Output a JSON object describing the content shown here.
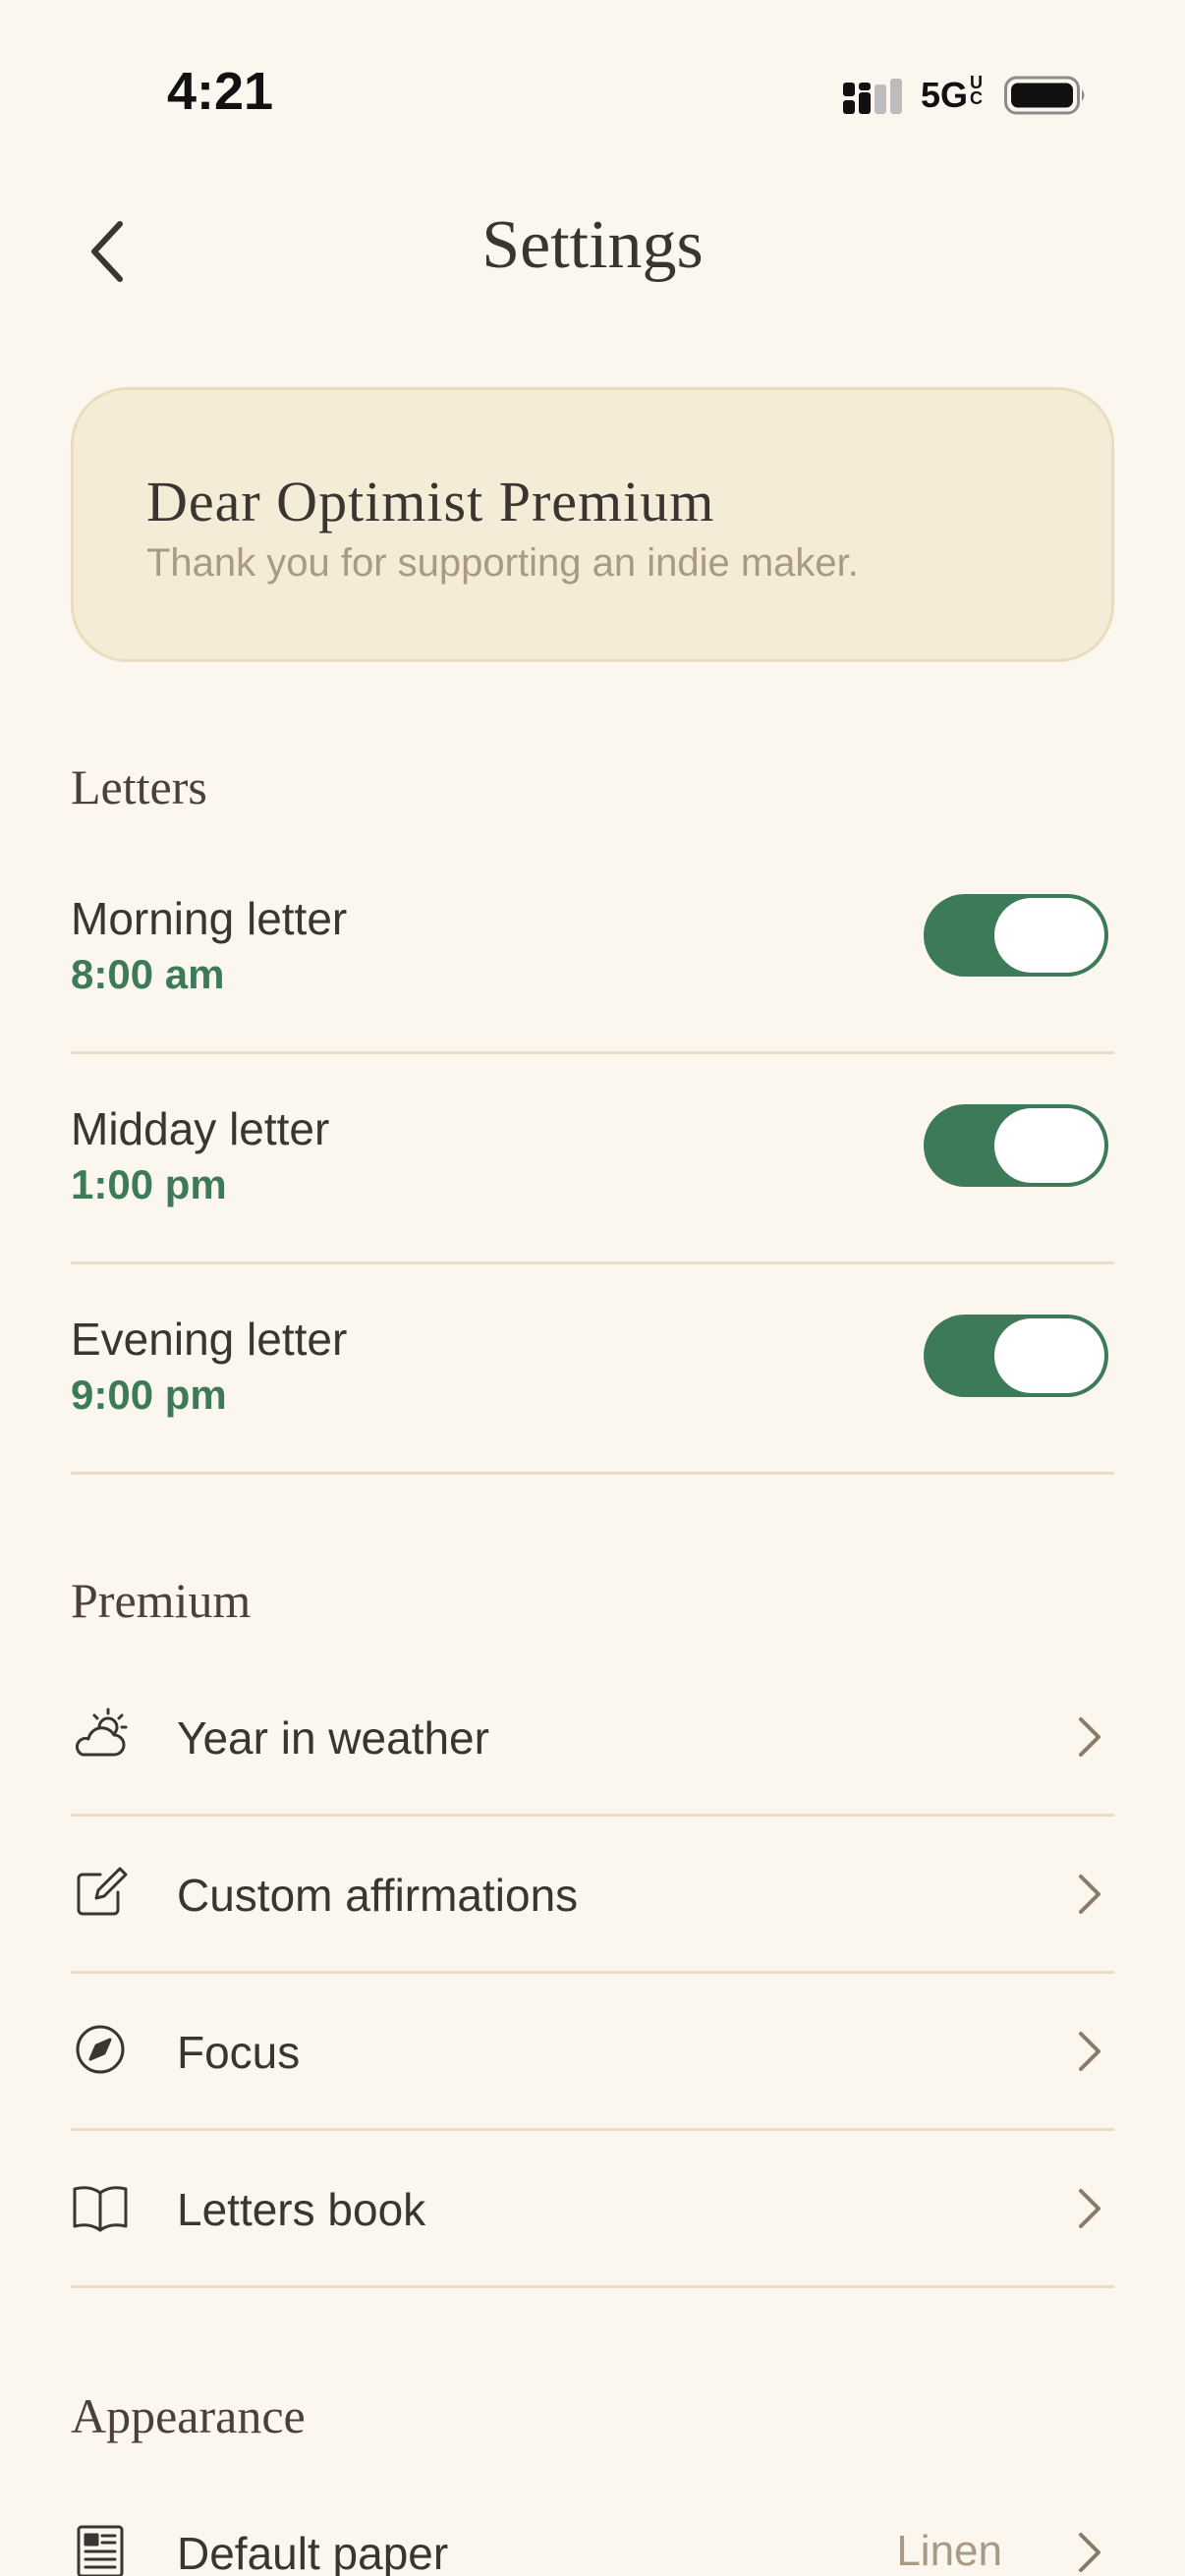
{
  "status_bar": {
    "time": "4:21",
    "network": "5G",
    "network_suffix": "UC"
  },
  "header": {
    "title": "Settings",
    "back_icon": "chevron-left-icon"
  },
  "premium_card": {
    "title": "Dear Optimist Premium",
    "subtitle": "Thank you for supporting an indie maker."
  },
  "letters": {
    "header": "Letters",
    "items": [
      {
        "label": "Morning letter",
        "time": "8:00 am",
        "enabled": true
      },
      {
        "label": "Midday letter",
        "time": "1:00 pm",
        "enabled": true
      },
      {
        "label": "Evening letter",
        "time": "9:00 pm",
        "enabled": true
      }
    ]
  },
  "premium": {
    "header": "Premium",
    "items": [
      {
        "label": "Year in weather",
        "icon": "cloud-sun-icon"
      },
      {
        "label": "Custom affirmations",
        "icon": "edit-square-icon"
      },
      {
        "label": "Focus",
        "icon": "compass-icon"
      },
      {
        "label": "Letters book",
        "icon": "open-book-icon"
      }
    ]
  },
  "appearance": {
    "header": "Appearance",
    "items": [
      {
        "label": "Default paper",
        "value": "Linen",
        "icon": "newspaper-icon"
      }
    ]
  },
  "colors": {
    "background": "#FBF7EF",
    "accent_green": "#3C7A58",
    "card_bg": "#F5ECD8",
    "muted_text": "#A89A84",
    "divider": "#EADFC6"
  }
}
